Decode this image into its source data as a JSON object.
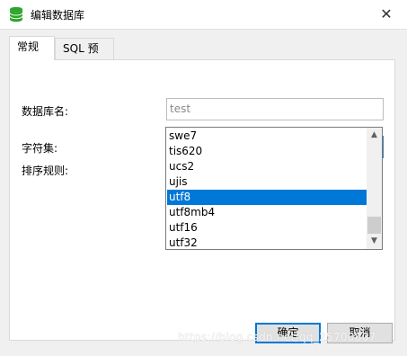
{
  "window": {
    "title": "编辑数据库",
    "close_glyph": "✕",
    "icon": "database-icon",
    "icon_color": "#2ca52c"
  },
  "tabs": [
    {
      "label": "常规",
      "active": true
    },
    {
      "label": "SQL 预览",
      "active": false
    }
  ],
  "form": {
    "name_label": "数据库名:",
    "name_value": "test",
    "charset_label": "字符集:",
    "charset_value": "utf8",
    "collation_label": "排序规则:"
  },
  "dropdown": {
    "options": [
      "swe7",
      "tis620",
      "ucs2",
      "ujis",
      "utf8",
      "utf8mb4",
      "utf16",
      "utf32"
    ],
    "selected": "utf8",
    "selected_color": "#0078d7"
  },
  "buttons": {
    "ok": "确定",
    "cancel": "取消"
  },
  "watermark": "https://blog.csdn.net/qq_25700807"
}
